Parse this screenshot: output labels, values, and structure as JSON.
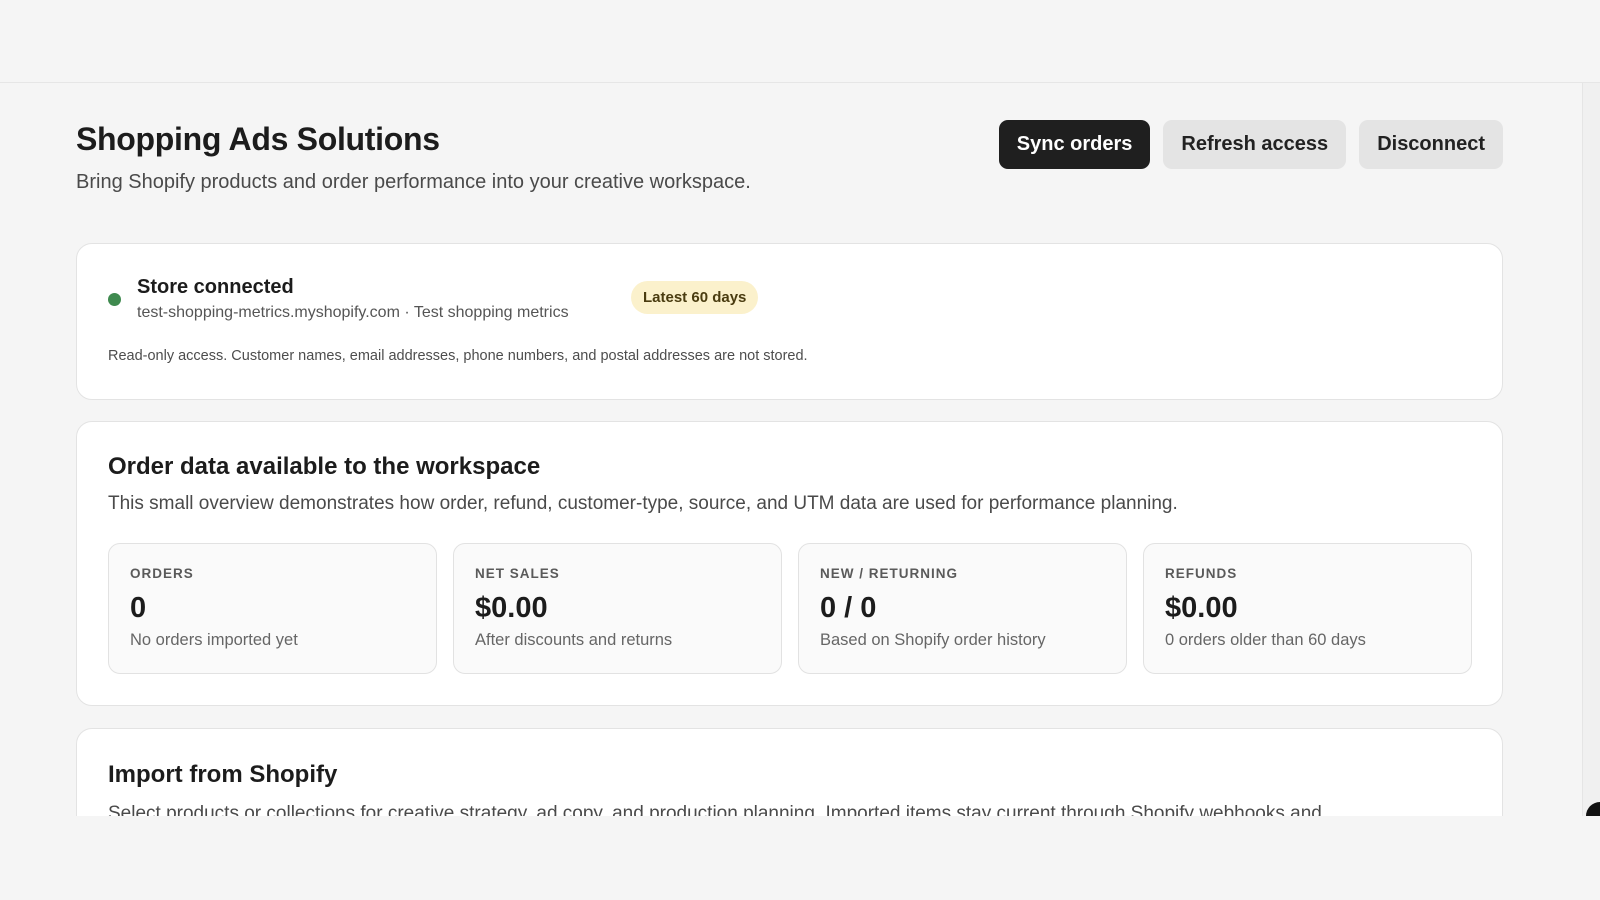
{
  "header": {
    "title": "Shopping Ads Solutions",
    "subtitle": "Bring Shopify products and order performance into your creative workspace."
  },
  "actions": {
    "sync_label": "Sync orders",
    "refresh_label": "Refresh access",
    "disconnect_label": "Disconnect"
  },
  "store": {
    "status": "Store connected",
    "domain_line": "test-shopping-metrics.myshopify.com · Test shopping metrics",
    "range_badge": "Latest 60 days",
    "privacy_note": "Read-only access. Customer names, email addresses, phone numbers, and postal addresses are not stored.",
    "status_color": "#3f8a4f"
  },
  "orders_card": {
    "title": "Order data available to the workspace",
    "description": "This small overview demonstrates how order, refund, customer-type, source, and UTM data are used for performance planning.",
    "metrics": [
      {
        "label": "ORDERS",
        "value": "0",
        "sub": "No orders imported yet"
      },
      {
        "label": "NET SALES",
        "value": "$0.00",
        "sub": "After discounts and returns"
      },
      {
        "label": "NEW / RETURNING",
        "value": "0 / 0",
        "sub": "Based on Shopify order history"
      },
      {
        "label": "REFUNDS",
        "value": "$0.00",
        "sub": "0 orders older than 60 days"
      }
    ]
  },
  "import_card": {
    "title": "Import from Shopify",
    "description": "Select products or collections for creative strategy, ad copy, and production planning. Imported items stay current through Shopify webhooks and"
  },
  "colors": {
    "primary_button": "#1f1f1f",
    "secondary_button": "#e4e4e4",
    "badge_bg": "#fbf1cc",
    "page_bg": "#f5f5f5"
  }
}
